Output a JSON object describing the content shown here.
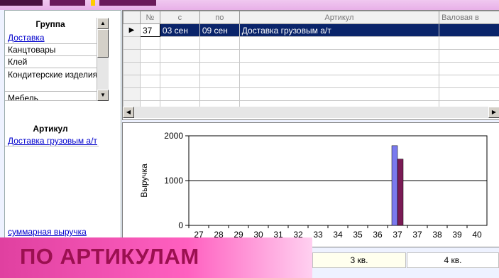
{
  "left": {
    "group_header": "Группа",
    "groups": [
      "Доставка",
      "Канцтовары",
      "Клей",
      "Кондитерские изделия",
      "Мебель"
    ],
    "article_header": "Артикул",
    "articles": [
      "Доставка грузовым а/т"
    ],
    "summary_link": "суммарная выручка"
  },
  "grid": {
    "columns": [
      "№",
      "с",
      "по",
      "Артикул",
      "Валовая в"
    ],
    "selected_row": {
      "num": "37",
      "from": "03 сен",
      "to": "09 сен",
      "article": "Доставка грузовым а/т"
    }
  },
  "chart_data": {
    "type": "bar",
    "ylabel": "Выручка",
    "ylim": [
      0,
      2000
    ],
    "yticks": [
      "0",
      "1000",
      "2000"
    ],
    "categories": [
      "27",
      "28",
      "29",
      "30",
      "31",
      "32",
      "33",
      "34",
      "35",
      "36",
      "37",
      "37",
      "38",
      "39",
      "40"
    ],
    "series": [
      {
        "values": [
          0,
          0,
          0,
          0,
          0,
          0,
          0,
          0,
          0,
          0,
          1780,
          0,
          0,
          0,
          0
        ],
        "color": "#7a7aee"
      },
      {
        "values": [
          0,
          0,
          0,
          0,
          0,
          0,
          0,
          0,
          0,
          0,
          1480,
          0,
          0,
          0,
          0
        ],
        "color": "#7a1b55"
      }
    ],
    "grid": true
  },
  "bottom": {
    "banner": "ПО АРТИКУЛАМ",
    "quarters": [
      "3 кв.",
      "4 кв."
    ]
  }
}
